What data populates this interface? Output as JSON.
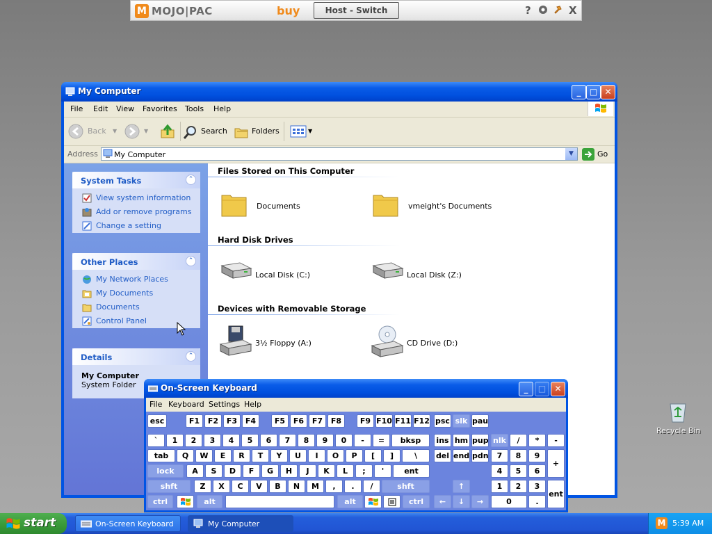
{
  "mojopac": {
    "brand": "MOJO|PAC",
    "buy_label": "buy",
    "host_switch_label": "Host - Switch",
    "icons": [
      "help-icon",
      "settings-icon",
      "pin-icon",
      "close-icon"
    ],
    "help_glyph": "?",
    "close_glyph": "X"
  },
  "my_computer": {
    "title": "My Computer",
    "menu": [
      "File",
      "Edit",
      "View",
      "Favorites",
      "Tools",
      "Help"
    ],
    "toolbar": {
      "back_label": "Back",
      "search_label": "Search",
      "folders_label": "Folders"
    },
    "address": {
      "label": "Address",
      "value": "My Computer",
      "go_label": "Go"
    },
    "task_pane": {
      "system_tasks": {
        "title": "System Tasks",
        "links": [
          "View system information",
          "Add or remove programs",
          "Change a setting"
        ]
      },
      "other_places": {
        "title": "Other Places",
        "links": [
          "My Network Places",
          "My Documents",
          "Documents",
          "Control Panel"
        ]
      },
      "details": {
        "title": "Details",
        "name": "My Computer",
        "type": "System Folder"
      }
    },
    "groups": [
      {
        "title": "Files Stored on This Computer",
        "items": [
          "Documents",
          "vmeight's Documents"
        ]
      },
      {
        "title": "Hard Disk Drives",
        "items": [
          "Local Disk (C:)",
          "Local Disk (Z:)"
        ]
      },
      {
        "title": "Devices with Removable Storage",
        "items": [
          "3½ Floppy (A:)",
          "CD Drive (D:)"
        ]
      }
    ]
  },
  "osk": {
    "title": "On-Screen Keyboard",
    "menu": [
      "File",
      "Keyboard",
      "Settings",
      "Help"
    ],
    "keys": {
      "esc": "esc",
      "f1": "F1",
      "f2": "F2",
      "f3": "F3",
      "f4": "F4",
      "f5": "F5",
      "f6": "F6",
      "f7": "F7",
      "f8": "F8",
      "f9": "F9",
      "f10": "F10",
      "f11": "F11",
      "f12": "F12",
      "psc": "psc",
      "slk": "slk",
      "pau": "pau",
      "backtick": "`",
      "n1": "1",
      "n2": "2",
      "n3": "3",
      "n4": "4",
      "n5": "5",
      "n6": "6",
      "n7": "7",
      "n8": "8",
      "n9": "9",
      "n0": "0",
      "minus": "-",
      "equals": "=",
      "bksp": "bksp",
      "ins": "ins",
      "hm": "hm",
      "pup": "pup",
      "nlk": "nlk",
      "kslash": "/",
      "kstar": "*",
      "kminus": "-",
      "tab": "tab",
      "q": "Q",
      "w": "W",
      "e": "E",
      "r": "R",
      "t": "T",
      "y": "Y",
      "u": "U",
      "i": "I",
      "o": "O",
      "p": "P",
      "lbr": "[",
      "rbr": "]",
      "bslash": "\\",
      "del": "del",
      "end": "end",
      "pdn": "pdn",
      "k7": "7",
      "k8": "8",
      "k9": "9",
      "kplus": "+",
      "lock": "lock",
      "a": "A",
      "s": "S",
      "d": "D",
      "f": "F",
      "g": "G",
      "h": "H",
      "j": "J",
      "k": "K",
      "l": "L",
      "semi": ";",
      "quote": "'",
      "ent": "ent",
      "k4": "4",
      "k5": "5",
      "k6": "6",
      "shft": "shft",
      "z": "Z",
      "x": "X",
      "c": "C",
      "v": "V",
      "b": "B",
      "n": "N",
      "m": "M",
      "comma": ",",
      "period": ".",
      "slash": "/",
      "up": "↑",
      "k1": "1",
      "k2": "2",
      "k3": "3",
      "kent": "ent",
      "ctrl": "ctrl",
      "alt": "alt",
      "left": "←",
      "down": "↓",
      "right": "→",
      "k0": "0",
      "kdot": "."
    }
  },
  "taskbar": {
    "start_label": "start",
    "tasks": [
      "On-Screen Keyboard",
      "My Computer"
    ],
    "clock": "5:39 AM"
  },
  "desktop": {
    "recycle_bin_label": "Recycle Bin"
  }
}
